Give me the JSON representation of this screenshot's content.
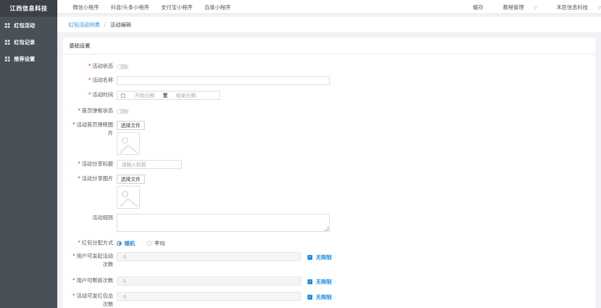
{
  "sidebar": {
    "brand": "江西信息科技",
    "items": [
      {
        "label": "红包活动"
      },
      {
        "label": "红包记录"
      },
      {
        "label": "推荐设置"
      }
    ]
  },
  "topbar": {
    "tabs": [
      "微信小程序",
      "抖音/头条小程序",
      "支付宝小程序",
      "百度小程序"
    ],
    "right": {
      "cache": "缓存",
      "tutorial": "教程管理",
      "user": "禾匠信息科技"
    }
  },
  "breadcrumb": {
    "parent": "红包活动列表",
    "separator": "/",
    "current": "活动编辑"
  },
  "panel": {
    "title": "基础设置",
    "status_label": "活动状态",
    "name_label": "活动名称",
    "time_label": "活动时间",
    "time_start_placeholder": "开始日期",
    "time_to": "至",
    "time_end_placeholder": "结束日期",
    "popup_status_label": "首页弹框状态",
    "popup_image_label_1": "活动首页弹框图",
    "popup_image_label_2": "片",
    "choose_file_1": "选择文件",
    "share_title_label": "活动分享标题",
    "share_title_placeholder": "请输入标题",
    "share_image_label": "活动分享图片",
    "choose_file_2": "选择文件",
    "rules_label": "活动规则",
    "distribution_label": "红包分配方式",
    "distribution_options": [
      "随机",
      "平均"
    ],
    "distribution_selected": "随机",
    "launch_label_1": "用户可发起活动",
    "launch_label_2": "次数",
    "launch_value": "-1",
    "help_label": "用户可帮拆次数",
    "help_value": "-1",
    "total_label_1": "活动可发红包总",
    "total_label_2": "次数",
    "total_value": "-1",
    "unlimited": "无限制"
  }
}
